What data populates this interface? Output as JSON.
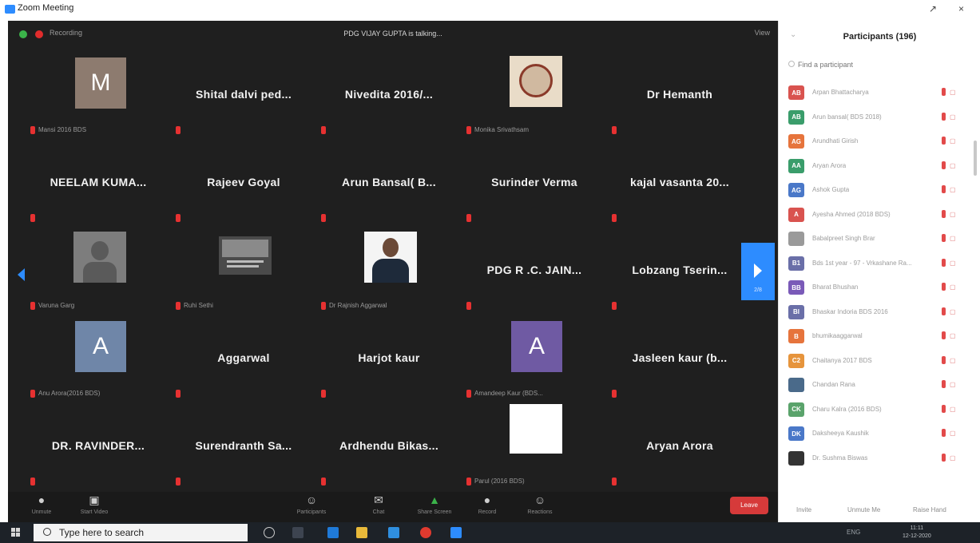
{
  "window": {
    "title": "Zoom Meeting",
    "controls": [
      "↗",
      "×"
    ]
  },
  "meeting": {
    "recording_label": "Recording",
    "talking": "PDG VIJAY GUPTA is talking...",
    "view_label": "View",
    "page_number": "2/8",
    "tiles": [
      {
        "kind": "letter",
        "letter": "M",
        "color": "#8d7b6f",
        "caption": "Mansi 2016 BDS"
      },
      {
        "kind": "name",
        "name": "Shital dalvi ped...",
        "caption": ""
      },
      {
        "kind": "name",
        "name": "Nivedita 2016/...",
        "caption": ""
      },
      {
        "kind": "photo",
        "photo": "emblem",
        "caption": "Monika Srivathsam"
      },
      {
        "kind": "name",
        "name": "Dr Hemanth",
        "caption": ""
      },
      {
        "kind": "name",
        "name": "NEELAM KUMA...",
        "caption": ""
      },
      {
        "kind": "name",
        "name": "Rajeev Goyal",
        "caption": ""
      },
      {
        "kind": "name",
        "name": "Arun Bansal( B...",
        "caption": ""
      },
      {
        "kind": "name",
        "name": "Surinder Verma",
        "caption": ""
      },
      {
        "kind": "name",
        "name": "kajal vasanta 20...",
        "caption": ""
      },
      {
        "kind": "photo",
        "photo": "portrait-grey",
        "caption": "Varuna Garg"
      },
      {
        "kind": "photo",
        "photo": "screen",
        "caption": "Ruhi Sethi"
      },
      {
        "kind": "photo",
        "photo": "man-suit",
        "caption": "Dr Rajnish Aggarwal"
      },
      {
        "kind": "name",
        "name": "PDG R .C. JAIN...",
        "caption": ""
      },
      {
        "kind": "name",
        "name": "Lobzang Tserin...",
        "caption": ""
      },
      {
        "kind": "letter",
        "letter": "A",
        "color": "#6f86a8",
        "caption": "Anu Arora(2016 BDS)"
      },
      {
        "kind": "name",
        "name": "Aggarwal",
        "caption": ""
      },
      {
        "kind": "name",
        "name": "Harjot kaur",
        "caption": ""
      },
      {
        "kind": "letter",
        "letter": "A",
        "color": "#6f5aa3",
        "caption": "Amandeep Kaur (BDS..."
      },
      {
        "kind": "name",
        "name": "Jasleen kaur (b...",
        "caption": ""
      },
      {
        "kind": "name",
        "name": "DR. RAVINDER...",
        "caption": ""
      },
      {
        "kind": "name",
        "name": "Surendranth Sa...",
        "caption": ""
      },
      {
        "kind": "name",
        "name": "Ardhendu Bikas...",
        "caption": ""
      },
      {
        "kind": "photo",
        "photo": "blank-white",
        "caption": "Parul (2016 BDS)"
      },
      {
        "kind": "name",
        "name": "Aryan Arora",
        "caption": ""
      }
    ]
  },
  "toolbar": {
    "unmute": "Unmute",
    "start_video": "Start Video",
    "participants": "Participants",
    "participants_count": "196",
    "chat": "Chat",
    "share_screen": "Share Screen",
    "record": "Record",
    "reactions": "Reactions",
    "leave": "Leave"
  },
  "participants_panel": {
    "title": "Participants (196)",
    "search_placeholder": "Find a participant",
    "items": [
      {
        "initials": "AB",
        "color": "#d9534f",
        "name": "Arpan Bhattacharya"
      },
      {
        "initials": "AB",
        "color": "#3a9d6b",
        "name": "Arun bansal( BDS 2018)"
      },
      {
        "initials": "AG",
        "color": "#e6743c",
        "name": "Arundhati Girish"
      },
      {
        "initials": "AA",
        "color": "#3a9d6b",
        "name": "Aryan Arora"
      },
      {
        "initials": "AG",
        "color": "#4a78c8",
        "name": "Ashok Gupta"
      },
      {
        "initials": "A",
        "color": "#d9534f",
        "name": "Ayesha Ahmed (2018 BDS)"
      },
      {
        "initials": "",
        "color": "#9a9a9a",
        "name": "Babalpreet Singh Brar"
      },
      {
        "initials": "B1",
        "color": "#6a6fa8",
        "name": "Bds 1st year - 97 - Vrkashane Ra..."
      },
      {
        "initials": "BB",
        "color": "#7a5ab8",
        "name": "Bharat Bhushan"
      },
      {
        "initials": "BI",
        "color": "#6a6fa8",
        "name": "Bhaskar Indoria BDS 2016"
      },
      {
        "initials": "B",
        "color": "#e6743c",
        "name": "bhumikaaggarwal"
      },
      {
        "initials": "C2",
        "color": "#e6943c",
        "name": "Chaitanya 2017 BDS"
      },
      {
        "initials": "",
        "color": "#4a6a8a",
        "name": "Chandan Rana"
      },
      {
        "initials": "CK",
        "color": "#5aa36b",
        "name": "Charu Kalra (2016 BDS)"
      },
      {
        "initials": "DK",
        "color": "#4a78c8",
        "name": "Daksheeya Kaushik"
      },
      {
        "initials": "",
        "color": "#333333",
        "name": "Dr. Sushma Biswas"
      }
    ],
    "footer": {
      "invite": "Invite",
      "unmute_me": "Unmute Me",
      "raise_hand": "Raise Hand"
    }
  },
  "taskbar": {
    "search_text": "Type here to search",
    "tray_text": "ENG",
    "time": "11:11",
    "date": "12-12-2020"
  }
}
